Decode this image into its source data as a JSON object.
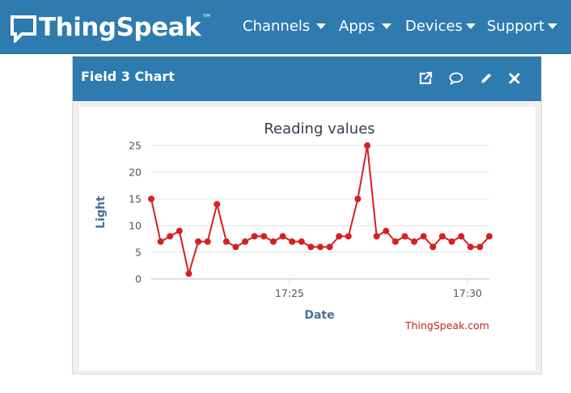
{
  "navbar": {
    "logo_text": "ThingSpeak",
    "logo_tm": "™",
    "items": [
      {
        "label": "Channels"
      },
      {
        "label": "Apps"
      },
      {
        "label": "Devices"
      },
      {
        "label": "Support"
      }
    ]
  },
  "panel": {
    "title": "Field 3 Chart"
  },
  "colors": {
    "brand": "#2e7bb0",
    "series": "#d62020",
    "axis_title": "#4a6f96",
    "credit": "#c22424"
  },
  "icons": [
    "popout-icon",
    "comment-icon",
    "pencil-icon",
    "close-icon"
  ],
  "chart_data": {
    "type": "line",
    "title": "Reading values",
    "xlabel": "Date",
    "ylabel": "Light",
    "credit": "ThingSpeak.com",
    "ylim": [
      0,
      25
    ],
    "yticks": [
      "0",
      "5",
      "10",
      "15",
      "20",
      "25"
    ],
    "xticks": [
      "17:25",
      "17:30"
    ],
    "grid": true,
    "series": [
      {
        "values": [
          15,
          7,
          8,
          9,
          1,
          7,
          7,
          14,
          7,
          6,
          7,
          8,
          8,
          7,
          8,
          7,
          7,
          6,
          6,
          6,
          8,
          8,
          15,
          25,
          8,
          9,
          7,
          8,
          7,
          8,
          6,
          8,
          7,
          8,
          6,
          6,
          8
        ]
      }
    ]
  }
}
